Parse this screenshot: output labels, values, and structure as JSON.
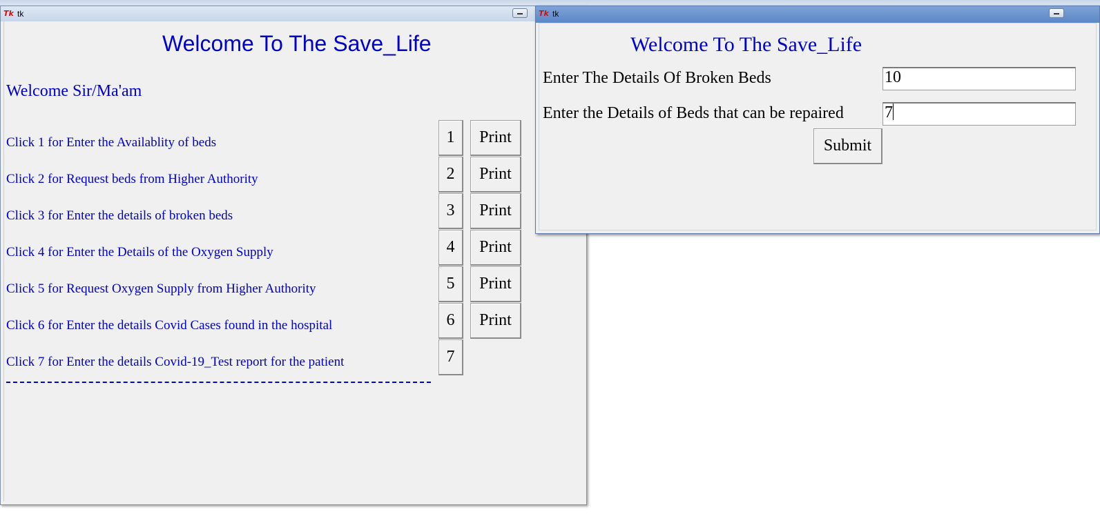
{
  "main_window": {
    "title": "tk",
    "heading": "Welcome To The Save_Life",
    "greeting": "Welcome Sir/Ma'am",
    "menu": [
      {
        "label": "Click 1 for Enter the Availablity of beds",
        "number": "1",
        "print": "Print"
      },
      {
        "label": "Click 2 for Request beds from Higher Authority",
        "number": "2",
        "print": "Print"
      },
      {
        "label": "Click 3 for Enter the details of broken beds",
        "number": "3",
        "print": "Print"
      },
      {
        "label": "Click 4 for Enter the Details of the Oxygen Supply",
        "number": "4",
        "print": "Print"
      },
      {
        "label": "Click 5 for Request Oxygen Supply from Higher Authority",
        "number": "5",
        "print": "Print"
      },
      {
        "label": "Click 6 for Enter the details Covid Cases found in the hospital",
        "number": "6",
        "print": "Print"
      },
      {
        "label": "Click 7 for Enter the details Covid-19_Test report for the patient",
        "number": "7"
      }
    ]
  },
  "dialog_window": {
    "title": "tk",
    "heading": "Welcome To The Save_Life",
    "broken_beds_label": "Enter The Details Of Broken Beds",
    "broken_beds_value": "10",
    "repairable_beds_label": "Enter the Details of Beds that can be repaired",
    "repairable_beds_value": "7",
    "submit_label": "Submit"
  }
}
